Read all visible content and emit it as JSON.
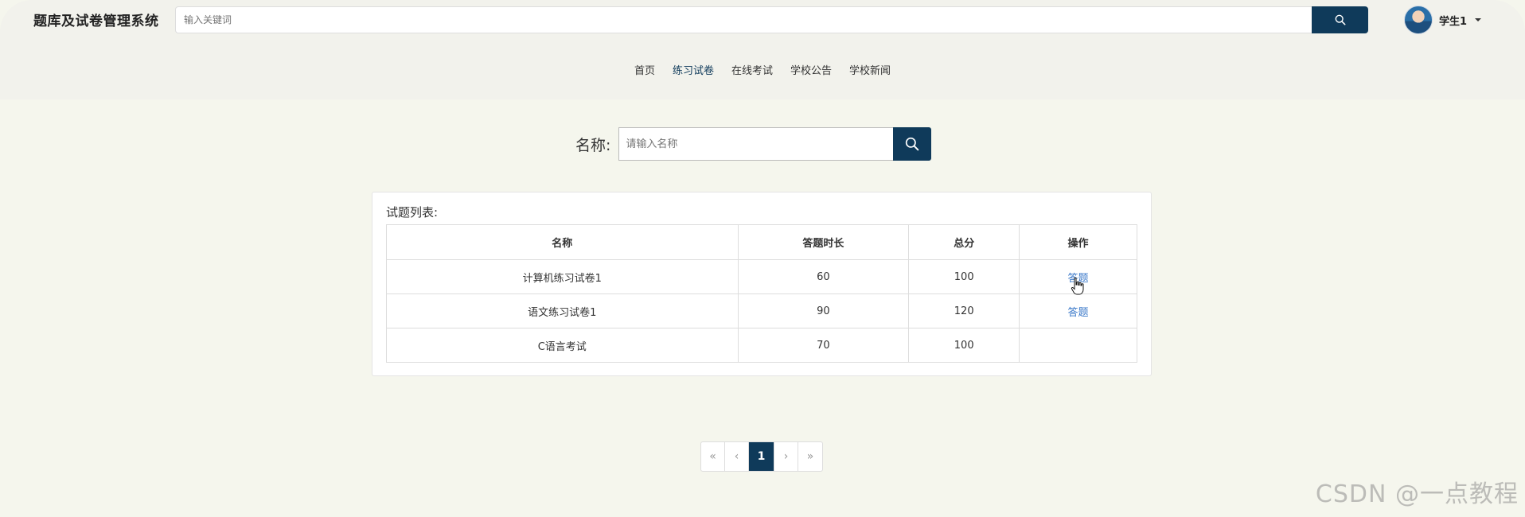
{
  "header": {
    "brand": "题库及试卷管理系统",
    "search_placeholder": "输入关键词",
    "user_name": "学生1"
  },
  "nav": {
    "items": [
      {
        "label": "首页",
        "active": false
      },
      {
        "label": "练习试卷",
        "active": true
      },
      {
        "label": "在线考试",
        "active": false
      },
      {
        "label": "学校公告",
        "active": false
      },
      {
        "label": "学校新闻",
        "active": false
      }
    ]
  },
  "filter": {
    "label": "名称:",
    "placeholder": "请输入名称"
  },
  "list": {
    "title": "试题列表:",
    "columns": [
      "名称",
      "答题时长",
      "总分",
      "操作"
    ],
    "rows": [
      {
        "name": "计算机练习试卷1",
        "duration": "60",
        "score": "100",
        "action": "答题"
      },
      {
        "name": "语文练习试卷1",
        "duration": "90",
        "score": "120",
        "action": "答题"
      },
      {
        "name": "C语言考试",
        "duration": "70",
        "score": "100",
        "action": ""
      }
    ]
  },
  "pager": {
    "first": "«",
    "prev": "‹",
    "current": "1",
    "next": "›",
    "last": "»"
  },
  "watermark": "CSDN @一点教程",
  "colors": {
    "primary": "#0f3a5a",
    "link": "#3a78c9",
    "page_bg": "#f5f6ed"
  }
}
